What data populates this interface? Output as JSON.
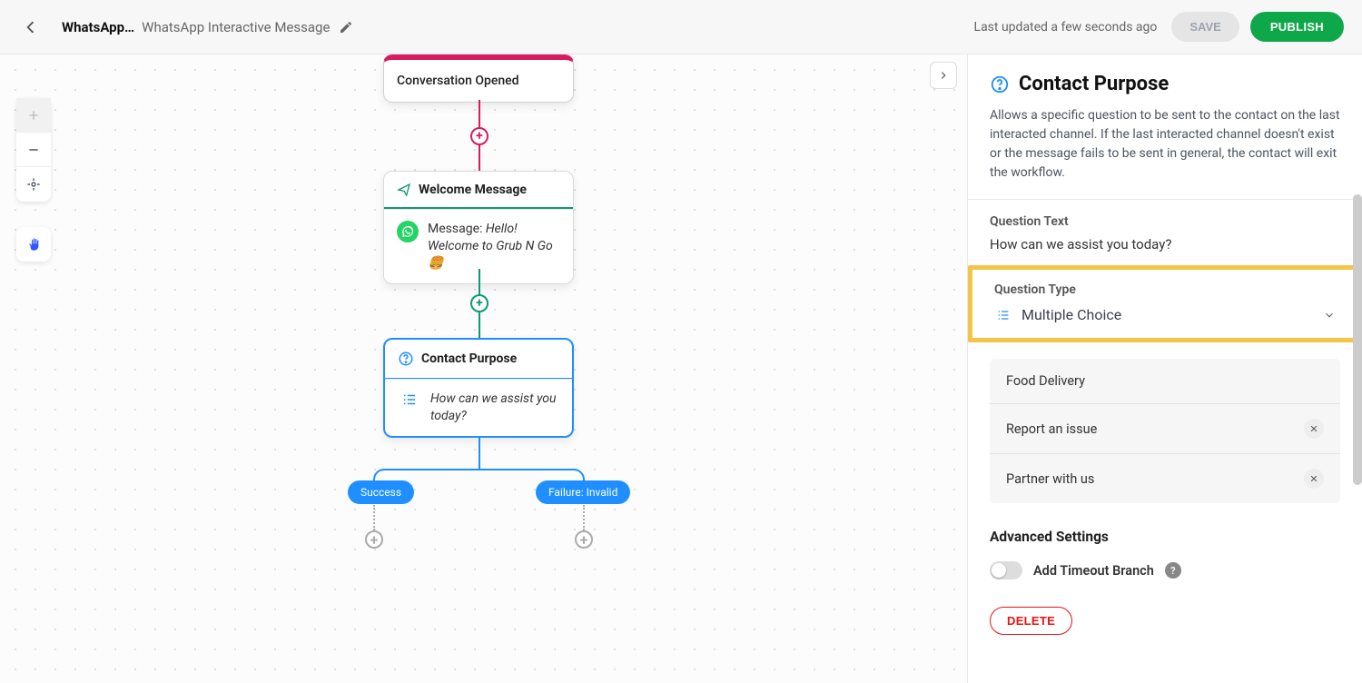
{
  "header": {
    "workflow_name": "WhatsApp…",
    "workflow_subtitle": "WhatsApp Interactive Message",
    "last_updated": "Last updated a few seconds ago",
    "save_label": "SAVE",
    "publish_label": "PUBLISH"
  },
  "canvas": {
    "nodes": {
      "conversation_opened": {
        "title": "Conversation Opened"
      },
      "welcome_message": {
        "title": "Welcome Message",
        "body_prefix": "Message: ",
        "body_text": "Hello! Welcome to Grub N Go 🍔"
      },
      "contact_purpose": {
        "title": "Contact Purpose",
        "question": "How can we assist you today?"
      }
    },
    "branches": {
      "success": "Success",
      "failure": "Failure: Invalid"
    }
  },
  "panel": {
    "title": "Contact Purpose",
    "description": "Allows a specific question to be sent to the contact on the last interacted channel. If the last interacted channel doesn't exist or the message fails to be sent in general, the contact will exit the workflow.",
    "question_text_label": "Question Text",
    "question_text_value": "How can we assist you today?",
    "question_type_label": "Question Type",
    "question_type_value": "Multiple Choice",
    "choices": [
      "Food Delivery",
      "Report an issue",
      "Partner with us"
    ],
    "advanced_label": "Advanced Settings",
    "timeout_label": "Add Timeout Branch",
    "delete_label": "DELETE"
  }
}
